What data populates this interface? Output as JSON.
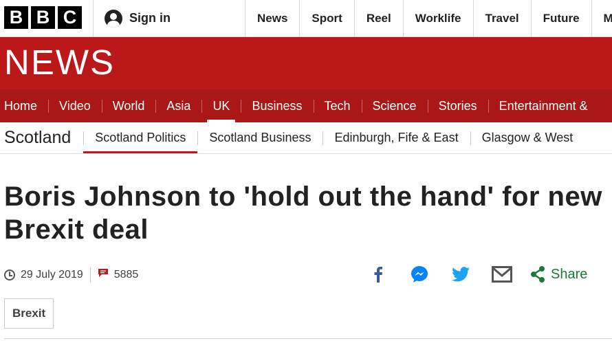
{
  "masthead": {
    "logo_letters": [
      "B",
      "B",
      "C"
    ],
    "signin_label": "Sign in",
    "nav": [
      "News",
      "Sport",
      "Reel",
      "Worklife",
      "Travel",
      "Future",
      "M"
    ]
  },
  "banner": {
    "title": "NEWS"
  },
  "primary_nav": {
    "items": [
      "Home",
      "Video",
      "World",
      "Asia",
      "UK",
      "Business",
      "Tech",
      "Science",
      "Stories",
      "Entertainment &"
    ],
    "active": "UK"
  },
  "secondary_nav": {
    "section": "Scotland",
    "items": [
      "Scotland Politics",
      "Scotland Business",
      "Edinburgh, Fife & East",
      "Glasgow & West"
    ],
    "active": "Scotland Politics"
  },
  "article": {
    "headline": "Boris Johnson to 'hold out the hand' for new Brexit deal",
    "date": "29 July 2019",
    "comments": "5885",
    "share_label": "Share",
    "tag": "Brexit"
  },
  "share_icons": [
    "facebook-icon",
    "messenger-icon",
    "twitter-icon",
    "email-icon",
    "share-icon"
  ],
  "colors": {
    "brand_red": "#bb1919",
    "nav_red": "#a91717",
    "facebook_blue": "#3b5998",
    "twitter_blue": "#1da1f2",
    "share_green": "#1a7a3a"
  }
}
